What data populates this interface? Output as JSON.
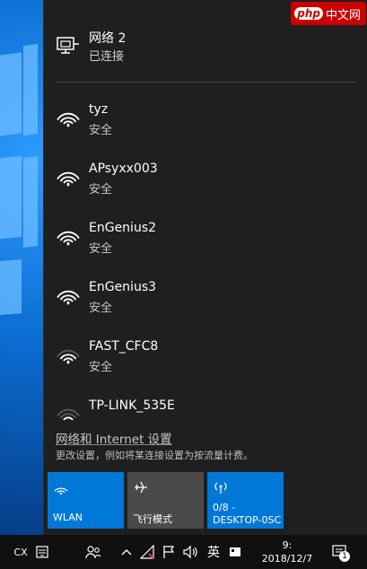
{
  "badge": {
    "logo": "php",
    "text": "中文网"
  },
  "wired": {
    "name": "网络  2",
    "status": "已连接"
  },
  "wifi": [
    {
      "ssid": "tyz",
      "security": "安全",
      "signal": 4
    },
    {
      "ssid": "APsyxx003",
      "security": "安全",
      "signal": 4
    },
    {
      "ssid": "EnGenius2",
      "security": "安全",
      "signal": 4
    },
    {
      "ssid": "EnGenius3",
      "security": "安全",
      "signal": 4
    },
    {
      "ssid": "FAST_CFC8",
      "security": "安全",
      "signal": 3
    },
    {
      "ssid": "TP-LINK_535E",
      "security": "",
      "signal": 2
    }
  ],
  "settings": {
    "link": "网络和 Internet 设置",
    "description": "更改设置，例如将某连接设置为按流量计费。"
  },
  "tiles": {
    "wlan": {
      "label": "WLAN",
      "active": true
    },
    "airplane": {
      "label": "飞行模式",
      "active": false
    },
    "hotspot": {
      "line1": "0/8 -",
      "line2": "DESKTOP-0SC",
      "active": true
    }
  },
  "taskbar": {
    "lang": "CX",
    "ime": "英",
    "time": "9:",
    "date": "2018/12/7",
    "notifications": "1"
  },
  "colors": {
    "accent": "#0078d7",
    "flyout_bg": "#1f1f1f",
    "tile_off": "#4a4a4a"
  }
}
